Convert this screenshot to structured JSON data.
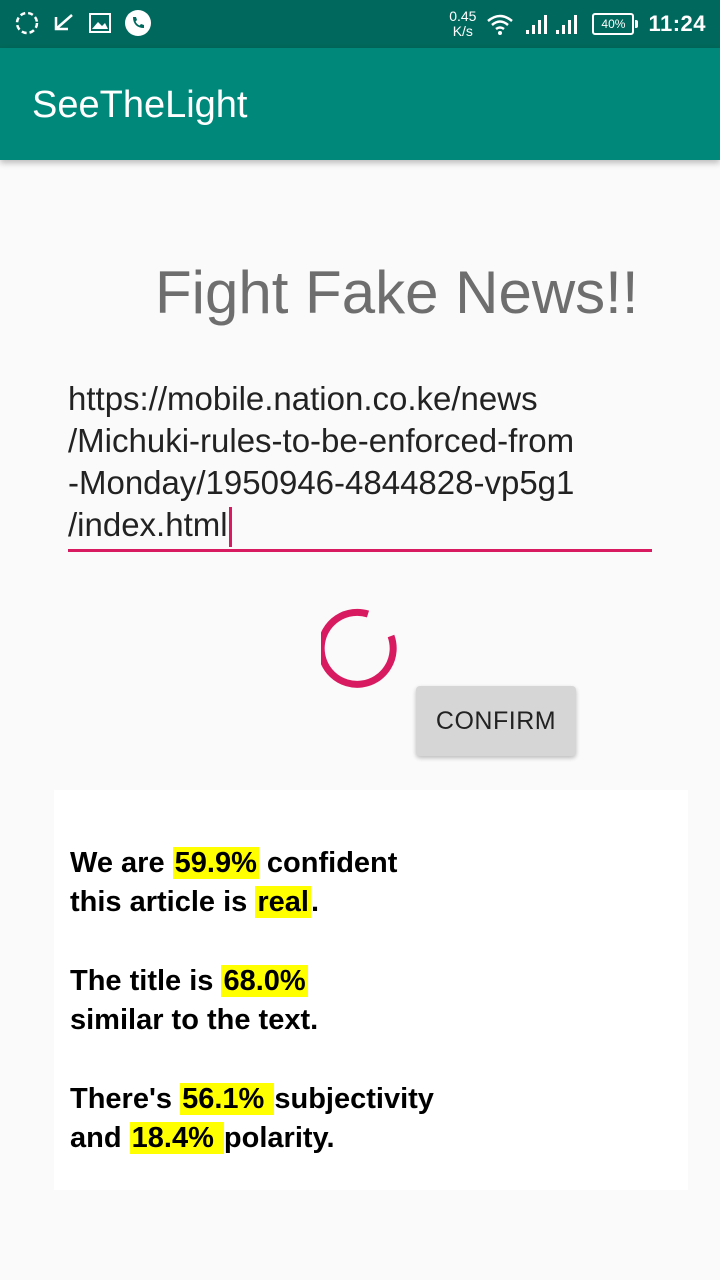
{
  "status_bar": {
    "speed_value": "0.45",
    "speed_unit": "K/s",
    "battery": "40%",
    "time": "11:24"
  },
  "app": {
    "title": "SeeTheLight"
  },
  "main": {
    "headline": "Fight Fake News!!",
    "url_lines": [
      "https://mobile.nation.co.ke/news",
      "/Michuki-rules-to-be-enforced-from",
      "-Monday/1950946-4844828-vp5g1",
      "/index.html"
    ],
    "confirm_label": "CONFIRM"
  },
  "results": {
    "confidence": {
      "prefix": "We are ",
      "value": "59.9%",
      "middle": " confident",
      "line2_prefix": "this article is ",
      "verdict": "real",
      "suffix": "."
    },
    "title_similarity": {
      "prefix": "The title is ",
      "value": "68.0% ",
      "line2": "similar to the text."
    },
    "sentiment": {
      "prefix": "There's ",
      "subjectivity": "56.1% ",
      "middle": "subjectivity",
      "line2_prefix": "and ",
      "polarity": "18.4% ",
      "suffix": "polarity."
    }
  },
  "colors": {
    "status_bar": "#00685c",
    "app_bar": "#00897b",
    "accent": "#d81b60",
    "highlight": "#ffff00"
  },
  "icons": [
    "sync-icon",
    "check-arrow-icon",
    "image-icon",
    "phone-icon",
    "wifi-icon",
    "signal-icon",
    "battery-icon"
  ]
}
